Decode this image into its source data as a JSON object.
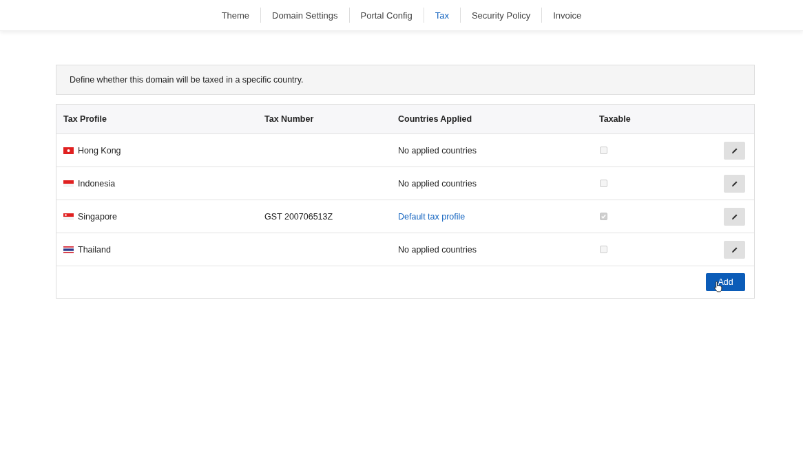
{
  "tabs": [
    {
      "label": "Theme",
      "selected": false
    },
    {
      "label": "Domain Settings",
      "selected": false
    },
    {
      "label": "Portal Config",
      "selected": false
    },
    {
      "label": "Tax",
      "selected": true
    },
    {
      "label": "Security Policy",
      "selected": false
    },
    {
      "label": "Invoice",
      "selected": false
    }
  ],
  "notice": "Define whether this domain will be taxed in a specific country.",
  "table": {
    "columns": [
      "Tax Profile",
      "Tax Number",
      "Countries Applied",
      "Taxable"
    ],
    "rows": [
      {
        "profile": "Hong Kong",
        "tax_number": "",
        "countries": {
          "kind": "text",
          "text": "No applied countries"
        },
        "taxable": false
      },
      {
        "profile": "Indonesia",
        "tax_number": "",
        "countries": {
          "kind": "text",
          "text": "No applied countries"
        },
        "taxable": false
      },
      {
        "profile": "Singapore",
        "tax_number": "GST 200706513Z",
        "countries": {
          "kind": "link",
          "text": "Default tax profile"
        },
        "taxable": true
      },
      {
        "profile": "Thailand",
        "tax_number": "",
        "countries": {
          "kind": "text",
          "text": "No applied countries"
        },
        "taxable": false
      }
    ]
  },
  "add_button": "Add"
}
